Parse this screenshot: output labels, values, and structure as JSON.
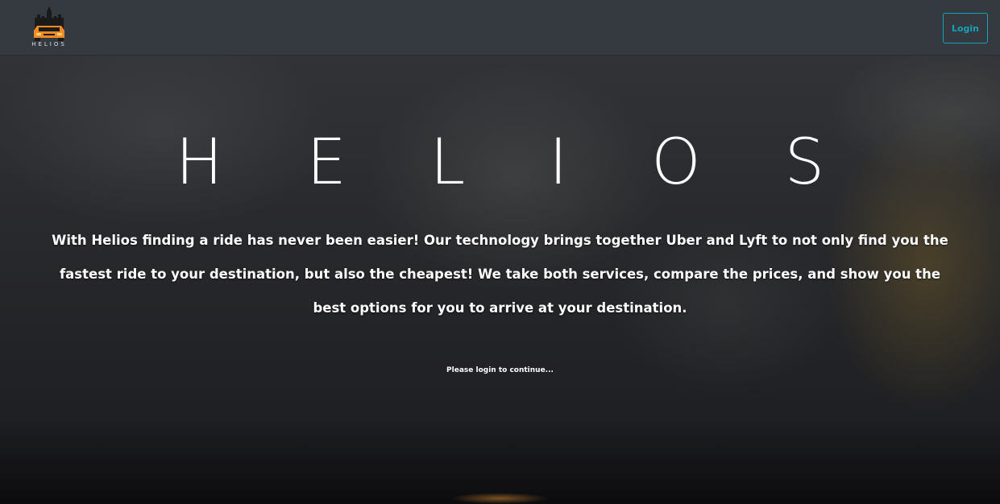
{
  "brand": {
    "name": "HELIOS",
    "logo_icon": "car-with-castle-logo",
    "accent_color": "#f08a24"
  },
  "nav": {
    "login_label": "Login",
    "login_color": "#17a2b8"
  },
  "hero": {
    "title": "HELIOS",
    "description": "With Helios finding a ride has never been easier! Our technology brings together Uber and Lyft to not only find you the fastest ride to your destination, but also the cheapest! We take both services, compare the prices, and show you the best options for you to arrive at your destination.",
    "login_prompt": "Please login to continue..."
  }
}
